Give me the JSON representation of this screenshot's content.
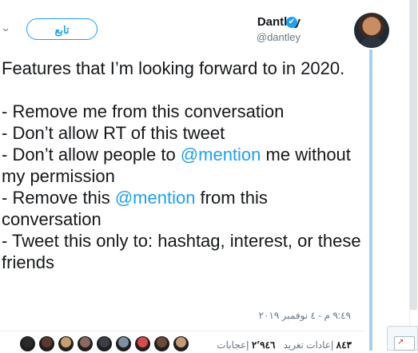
{
  "author": {
    "name": "Dantley",
    "handle": "@dantley",
    "verified": true,
    "verified_glyph": "✔"
  },
  "follow_label": "تابع",
  "menu_glyph": "⌄",
  "tweet": {
    "line1": "Features that I’m looking forward to in 2020.",
    "blank": "",
    "l1": "- Remove me from this conversation",
    "l2": "- Don’t allow RT of this tweet",
    "l3a": "- Don’t allow people to ",
    "l3m": "@mention",
    "l3b": " me without my permission",
    "l4a": "- Remove this ",
    "l4m": "@mention",
    "l4b": " from this conversation",
    "l5": "- Tweet this only to: hashtag, interest, or these friends"
  },
  "timestamp": "٩:٤٩ م - ٤ نوفمبر ٢٠١٩",
  "stats": {
    "retweets_count": "٨٤٣",
    "retweets_label": "إعادات تغريد",
    "likes_count": "٢٬٩٤٦",
    "likes_label": "إعجابات"
  },
  "colors": {
    "accent": "#1da1f2",
    "text": "#14171a",
    "muted": "#657786",
    "thread_line": "#a5d0f2"
  },
  "liker_colors": [
    "#2a2a2a",
    "#5b3a2e",
    "#c8a06a",
    "#8a6a5a",
    "#3b3f45",
    "#7f8fa6",
    "#d94a4a",
    "#6b4a3a",
    "#c79a76"
  ],
  "corner_widget_glyph": "↗"
}
